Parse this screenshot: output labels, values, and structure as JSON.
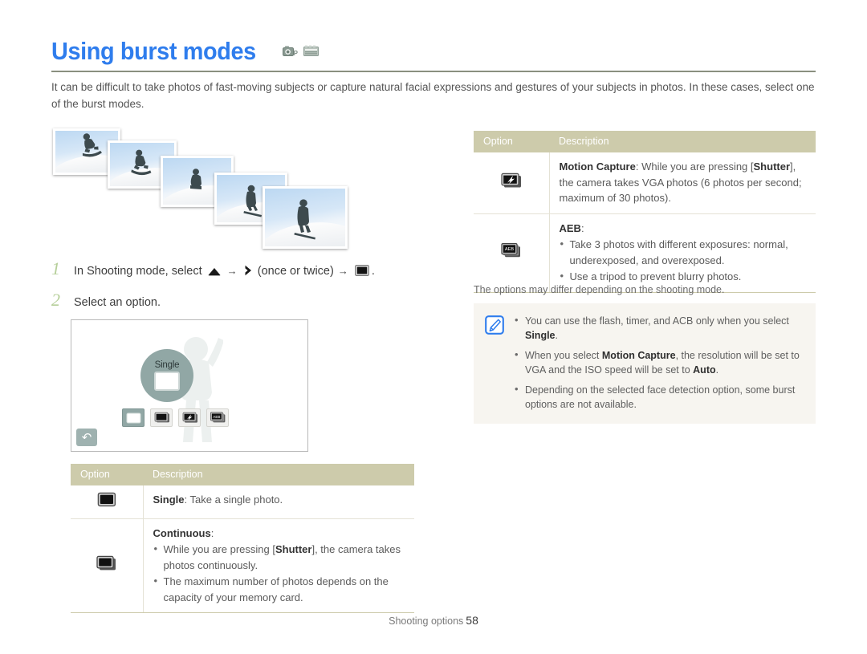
{
  "page": {
    "title": "Using burst modes",
    "title_icons": [
      "camera-p-mode-icon",
      "scene-mode-icon"
    ],
    "intro": "It can be difficult to take photos of fast-moving subjects or capture natural facial expressions and gestures of your subjects in photos. In these cases, select one of the burst modes."
  },
  "steps": [
    {
      "num": "1",
      "pre": "In Shooting mode, select",
      "mid": "(once or twice)",
      "post": ".",
      "icons": [
        "up-triangle-icon",
        "right-chevron-icon",
        "burst-mode-icon"
      ]
    },
    {
      "num": "2",
      "pre": "Select an option.",
      "mid": "",
      "post": "",
      "icons": []
    }
  ],
  "lcd": {
    "selected_label": "Single",
    "tiles": [
      "single-icon",
      "continuous-icon",
      "motion-capture-icon",
      "aeb-icon"
    ],
    "back_glyph": "↶"
  },
  "table_right": {
    "headers": [
      "Option",
      "Description"
    ],
    "rows": [
      {
        "icon": "motion-capture-icon",
        "title": "Motion Capture",
        "title_sep": ": ",
        "body": "While you are pressing [Shutter], the camera takes VGA photos (6 photos per second; maximum of 30 photos).",
        "bullets": []
      },
      {
        "icon": "aeb-icon",
        "title": "AEB",
        "title_sep": ":",
        "body": "",
        "bullets": [
          "Take 3 photos with different exposures: normal, underexposed, and overexposed.",
          "Use a tripod to prevent blurry photos."
        ]
      }
    ],
    "note": "The options may differ depending on the shooting mode."
  },
  "tipbox": {
    "icon": "note-pen-icon",
    "bullets": [
      "You can use the flash, timer, and ACB only when you select Single.",
      "When you select Motion Capture, the resolution will be set to VGA and the ISO speed will be set to Auto.",
      "Depending on the selected face detection option, some burst options are not available."
    ]
  },
  "table_left": {
    "headers": [
      "Option",
      "Description"
    ],
    "rows": [
      {
        "icon": "single-icon",
        "title": "Single",
        "title_sep": ": ",
        "body": "Take a single photo.",
        "bullets": []
      },
      {
        "icon": "continuous-icon",
        "title": "Continuous",
        "title_sep": ":",
        "body": "",
        "bullets": [
          "While you are pressing [Shutter], the camera takes photos continuously.",
          "The maximum number of photos depends on the capacity of your memory card."
        ]
      }
    ]
  },
  "footer": {
    "section": "Shooting options",
    "page_number": "58"
  },
  "colors": {
    "title_blue": "#2f7ded",
    "table_header": "#cdcbab",
    "tip_background": "#f7f5f0",
    "step_number": "#b6cf9a",
    "lcd_accent": "#91a7a5"
  }
}
